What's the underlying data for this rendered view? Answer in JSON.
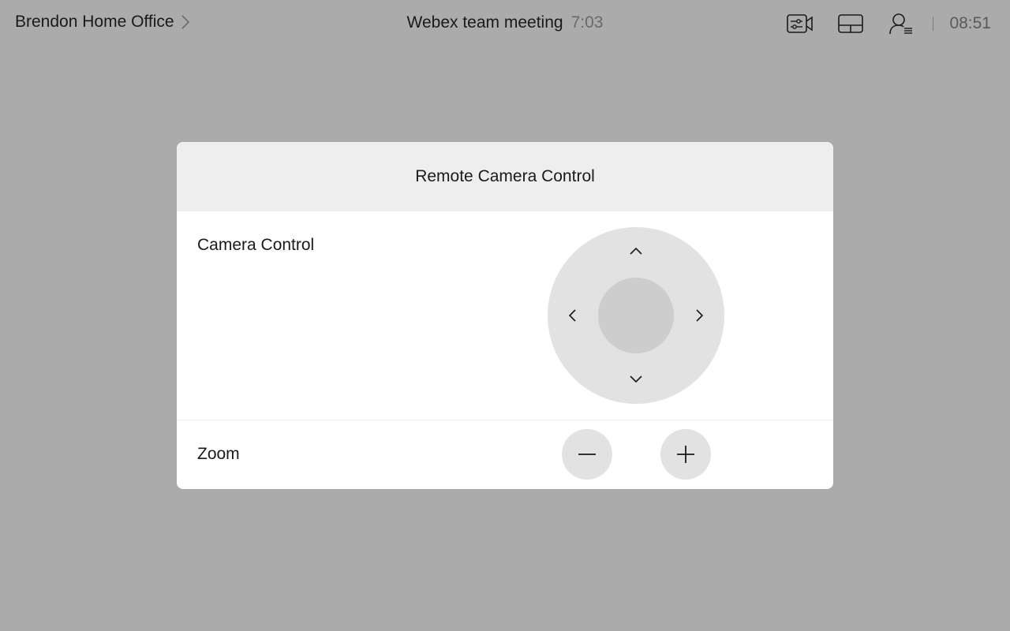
{
  "topbar": {
    "location": "Brendon Home Office",
    "meeting_title": "Webex team meeting",
    "meeting_duration": "7:03",
    "clock": "08:51",
    "icons": [
      "camera-controls-icon",
      "layout-icon",
      "participants-icon"
    ]
  },
  "dialog": {
    "title": "Remote Camera Control",
    "camera_label": "Camera Control",
    "zoom_label": "Zoom"
  },
  "colors": {
    "backdrop": "#ababab",
    "dialog_header": "#eeeeee",
    "control_bg": "#e2e2e2",
    "control_center": "#cdcdcd"
  }
}
